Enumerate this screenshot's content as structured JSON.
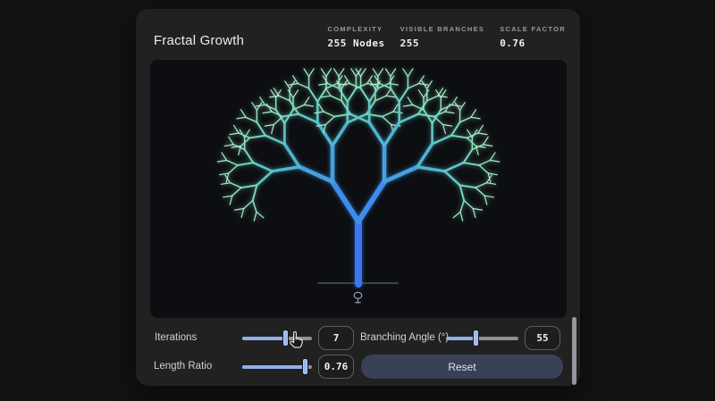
{
  "header": {
    "title": "Fractal Growth",
    "stats": [
      {
        "label": "COMPLEXITY",
        "value": "255 Nodes"
      },
      {
        "label": "VISIBLE BRANCHES",
        "value": "255"
      },
      {
        "label": "SCALE FACTOR",
        "value": "0.76"
      }
    ]
  },
  "controls": {
    "iterations": {
      "label": "Iterations",
      "value": "7"
    },
    "branching_angle": {
      "label": "Branching Angle (°)",
      "value": "55"
    },
    "length_ratio": {
      "label": "Length Ratio",
      "value": "0.76"
    },
    "reset_label": "Reset"
  },
  "icons": {
    "tree_marker": "tree-outline-icon",
    "cursor": "hand-pointer-icon"
  },
  "colors": {
    "page_bg": "#121212",
    "card_bg": "#212121",
    "canvas_bg": "#0c0e12",
    "slider_fill": "#8fafec",
    "reset_bg": "#3a4156",
    "trunk_blue": "#3b78f0",
    "tip_green": "#a9edc6"
  }
}
